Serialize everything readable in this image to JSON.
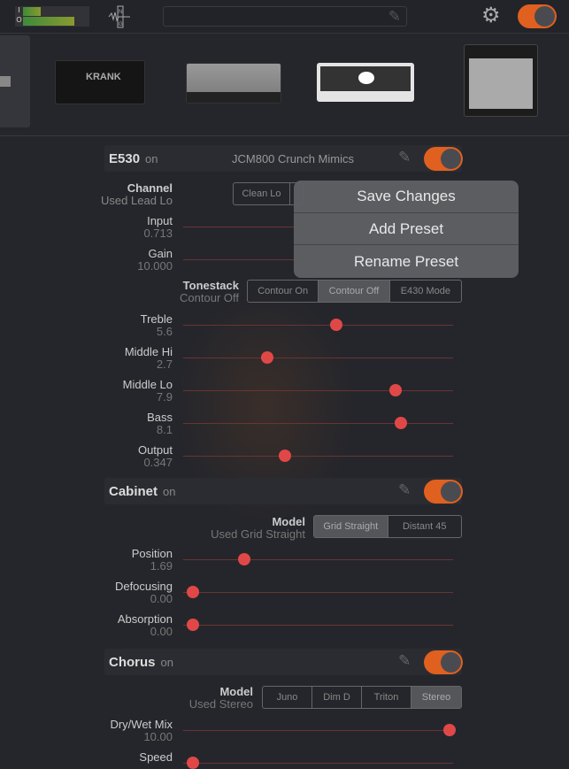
{
  "topbar": {
    "meter_in": "I",
    "meter_out": "O",
    "meter_in_level": 0.27,
    "meter_out_level": 0.77,
    "noise_gate_icon": "noise-gate-icon",
    "search_value": "",
    "power_on": true,
    "accent": "#e06020"
  },
  "amps": [
    "partial amp",
    "Krank",
    "Mesa Rectifier",
    "EVH 5150",
    "Fender combo"
  ],
  "popover": {
    "items": [
      "Save Changes",
      "Add Preset",
      "Rename Preset"
    ]
  },
  "amp_section": {
    "title": "E530",
    "state": "on",
    "preset": "JCM800 Crunch Mimics",
    "channel": {
      "label": "Channel",
      "used": "Used Lead Lo",
      "options": [
        "Clean Lo"
      ]
    },
    "input": {
      "label": "Input",
      "value": "0.713"
    },
    "gain": {
      "label": "Gain",
      "value": "10.000"
    },
    "tonestack": {
      "label": "Tonestack",
      "used": "Contour Off",
      "options": [
        "Contour On",
        "Contour Off",
        "E430 Mode"
      ],
      "selected": "Contour Off"
    },
    "sliders": [
      {
        "label": "Treble",
        "value": "5.6",
        "fraction": 0.56
      },
      {
        "label": "Middle Hi",
        "value": "2.7",
        "fraction": 0.29
      },
      {
        "label": "Middle Lo",
        "value": "7.9",
        "fraction": 0.79
      },
      {
        "label": "Bass",
        "value": "8.1",
        "fraction": 0.81
      },
      {
        "label": "Output",
        "value": "0.347",
        "fraction": 0.36
      }
    ]
  },
  "cabinet": {
    "title": "Cabinet",
    "state": "on",
    "model": {
      "label": "Model",
      "used": "Used Grid Straight",
      "options": [
        "Grid Straight",
        "Distant 45"
      ],
      "selected": "Grid Straight"
    },
    "sliders": [
      {
        "label": "Position",
        "value": "1.69",
        "fraction": 0.2
      },
      {
        "label": "Defocusing",
        "value": "0.00",
        "fraction": 0.0
      },
      {
        "label": "Absorption",
        "value": "0.00",
        "fraction": 0.0
      }
    ]
  },
  "chorus": {
    "title": "Chorus",
    "state": "on",
    "model": {
      "label": "Model",
      "used": "Used Stereo",
      "options": [
        "Juno",
        "Dim D",
        "Triton",
        "Stereo"
      ],
      "selected": "Stereo"
    },
    "sliders": [
      {
        "label": "Dry/Wet Mix",
        "value": "10.00",
        "fraction": 1.0
      },
      {
        "label": "Speed",
        "value": "",
        "fraction": 0.0
      }
    ]
  }
}
